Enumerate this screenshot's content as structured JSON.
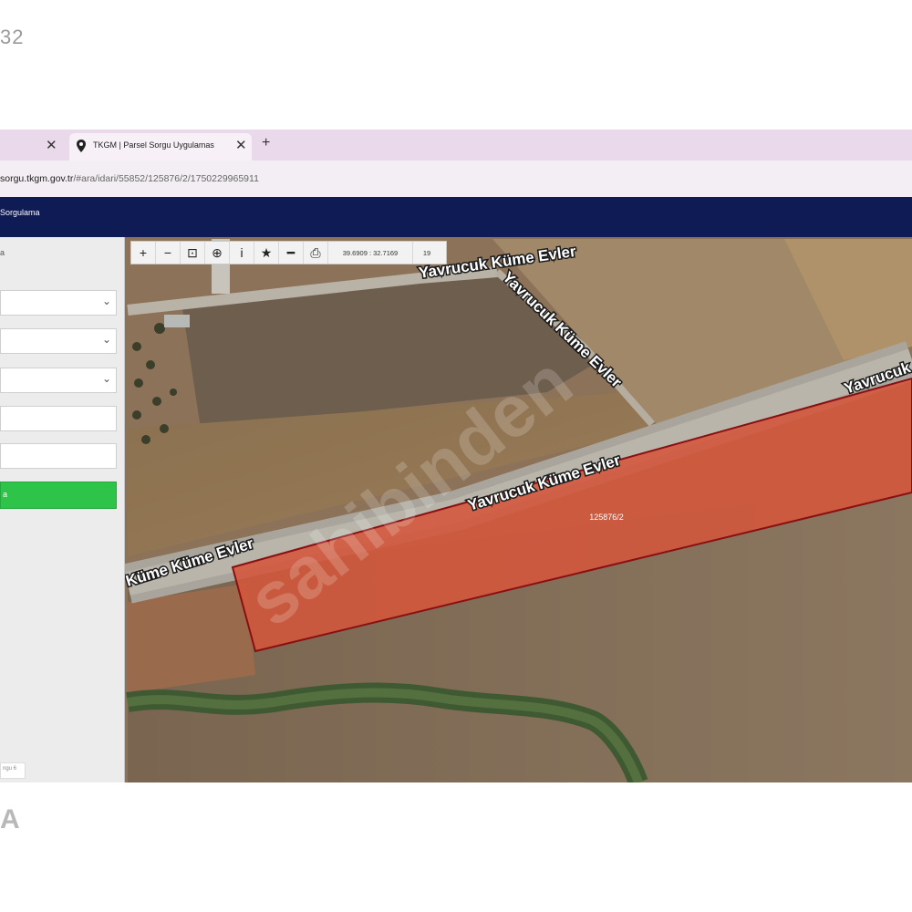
{
  "corner": {
    "top_text": "32",
    "bottom_text": "A"
  },
  "browser": {
    "tabs": [
      {
        "title": "",
        "close": "✕"
      },
      {
        "title": "TKGM | Parsel Sorgu Uygulamas",
        "close": "✕"
      }
    ],
    "new_tab": "+",
    "url_host": "sorgu.tkgm.gov.tr",
    "url_path": "/#ara/idari/55852/125876/2/1750229965911"
  },
  "app": {
    "header_title": "Sorgulama"
  },
  "panel": {
    "title": "a",
    "fields": [
      "",
      "",
      "",
      "",
      ""
    ],
    "query_button": "a",
    "footer_text": "ngu 6"
  },
  "toolbar": {
    "icons": [
      "zoom-in-icon",
      "zoom-out-icon",
      "extent-icon",
      "locate-icon",
      "info-icon",
      "star-icon",
      "measure-icon",
      "print-icon"
    ],
    "glyphs": [
      "+",
      "−",
      "⊡",
      "⊕",
      "i",
      "★",
      "━",
      "⎙"
    ],
    "coords": "39.6909 : 32.7169",
    "zoom": "19"
  },
  "map": {
    "road_labels": [
      "Yavrucuk Küme Evler",
      "Yavrucuk Küme Evler",
      "Yavrucuk Küme Evler",
      "Küme Küme Evler",
      "Yavrucuk"
    ],
    "parcel_label": "125876/2",
    "watermark": "sahibinden",
    "parcel_color": "#d4573b"
  }
}
